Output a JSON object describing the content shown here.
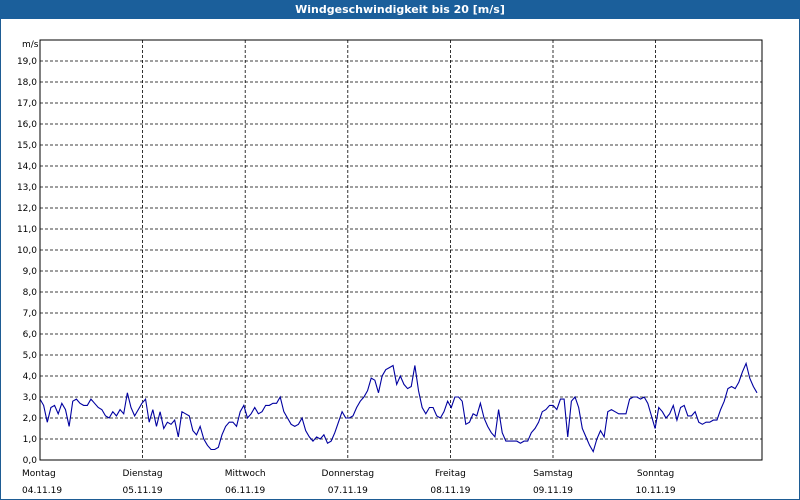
{
  "window": {
    "title": "Windgeschwindigkeit bis 20 [m/s]"
  },
  "colors": {
    "titlebar": "#1b5f9b",
    "line": "#0000a0",
    "grid": "#000000"
  },
  "chart_data": {
    "type": "line",
    "title": "Windgeschwindigkeit bis 20 [m/s]",
    "ylabel": "m/s",
    "ylim": [
      0,
      20
    ],
    "grid": true,
    "y_ticks": [
      "0,0",
      "1,0",
      "2,0",
      "3,0",
      "4,0",
      "5,0",
      "6,0",
      "7,0",
      "8,0",
      "9,0",
      "10,0",
      "11,0",
      "12,0",
      "13,0",
      "14,0",
      "15,0",
      "16,0",
      "17,0",
      "18,0",
      "19,0"
    ],
    "x_days": [
      {
        "weekday": "Montag",
        "date": "04.11.19"
      },
      {
        "weekday": "Dienstag",
        "date": "05.11.19"
      },
      {
        "weekday": "Mittwoch",
        "date": "06.11.19"
      },
      {
        "weekday": "Donnerstag",
        "date": "07.11.19"
      },
      {
        "weekday": "Freitag",
        "date": "08.11.19"
      },
      {
        "weekday": "Samstag",
        "date": "09.11.19"
      },
      {
        "weekday": "Sonntag",
        "date": "10.11.19"
      }
    ],
    "series": [
      {
        "values": [
          2.9,
          2.6,
          1.8,
          2.5,
          2.6,
          2.2,
          2.7,
          2.4,
          1.6,
          2.8,
          2.9,
          2.7,
          2.6,
          2.6,
          2.9,
          2.7,
          2.5,
          2.4,
          2.1,
          2.0,
          2.3,
          2.1,
          2.4,
          2.2,
          3.2,
          2.5,
          2.1,
          2.4,
          2.7,
          2.9,
          1.8,
          2.4,
          1.6,
          2.3,
          1.5,
          1.8,
          1.7,
          1.9,
          1.1,
          2.3,
          2.2,
          2.1,
          1.4,
          1.2,
          1.6,
          1.0,
          0.7,
          0.5,
          0.5,
          0.6,
          1.2,
          1.6,
          1.8,
          1.8,
          1.6,
          2.3,
          2.6,
          2.0,
          2.2,
          2.5,
          2.2,
          2.3,
          2.6,
          2.6,
          2.7,
          2.7,
          3.0,
          2.3,
          2.0,
          1.7,
          1.6,
          1.7,
          2.0,
          1.4,
          1.1,
          0.9,
          1.1,
          1.0,
          1.2,
          0.8,
          0.9,
          1.3,
          1.8,
          2.3,
          2.0,
          2.0,
          2.1,
          2.5,
          2.8,
          3.0,
          3.3,
          3.9,
          3.8,
          3.2,
          4.0,
          4.3,
          4.4,
          4.5,
          3.6,
          4.0,
          3.6,
          3.4,
          3.5,
          4.5,
          3.3,
          2.5,
          2.2,
          2.5,
          2.5,
          2.1,
          2.0,
          2.3,
          2.8,
          2.5,
          3.0,
          3.0,
          2.8,
          1.7,
          1.8,
          2.2,
          2.1,
          2.7,
          2.0,
          1.6,
          1.3,
          1.1,
          2.4,
          1.3,
          0.9,
          0.9,
          0.9,
          0.9,
          0.8,
          0.9,
          0.9,
          1.3,
          1.5,
          1.8,
          2.3,
          2.4,
          2.6,
          2.6,
          2.4,
          2.9,
          2.9,
          1.1,
          2.8,
          3.0,
          2.5,
          1.5,
          1.1,
          0.7,
          0.4,
          1.0,
          1.4,
          1.1,
          2.3,
          2.4,
          2.3,
          2.2,
          2.2,
          2.2,
          2.9,
          3.0,
          3.0,
          2.9,
          3.0,
          2.7,
          2.1,
          1.5,
          2.5,
          2.3,
          2.0,
          2.2,
          2.6,
          1.9,
          2.5,
          2.6,
          2.1,
          2.1,
          2.3,
          1.8,
          1.7,
          1.8,
          1.8,
          1.9,
          1.9,
          2.4,
          2.8,
          3.4,
          3.5,
          3.4,
          3.7,
          4.2,
          4.6,
          3.9,
          3.5,
          3.2
        ]
      }
    ]
  }
}
